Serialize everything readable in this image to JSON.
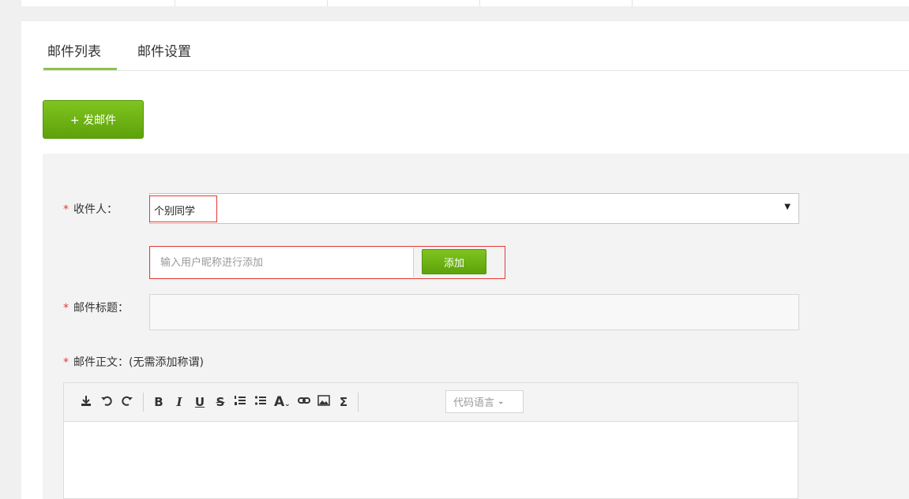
{
  "tabs": [
    {
      "label": "邮件列表",
      "active": true
    },
    {
      "label": "邮件设置",
      "active": false
    }
  ],
  "compose_label": "+ 发邮件",
  "form": {
    "required_mark": "*",
    "recipient": {
      "label": "收件人：",
      "value": "个别同学"
    },
    "nickname": {
      "placeholder": "输入用户昵称进行添加",
      "add_label": "添加"
    },
    "subject": {
      "label": "邮件标题：",
      "value": ""
    },
    "body": {
      "label": "邮件正文：(无需添加称谓)"
    }
  },
  "toolbar": {
    "bold": "B",
    "italic": "I",
    "underline": "U",
    "strike": "S",
    "font": "A",
    "sigma": "Σ",
    "language_placeholder": "代码语言"
  },
  "colors": {
    "accent_green": "#6cb418",
    "highlight_red": "#e53935",
    "required_red": "#e53935"
  }
}
